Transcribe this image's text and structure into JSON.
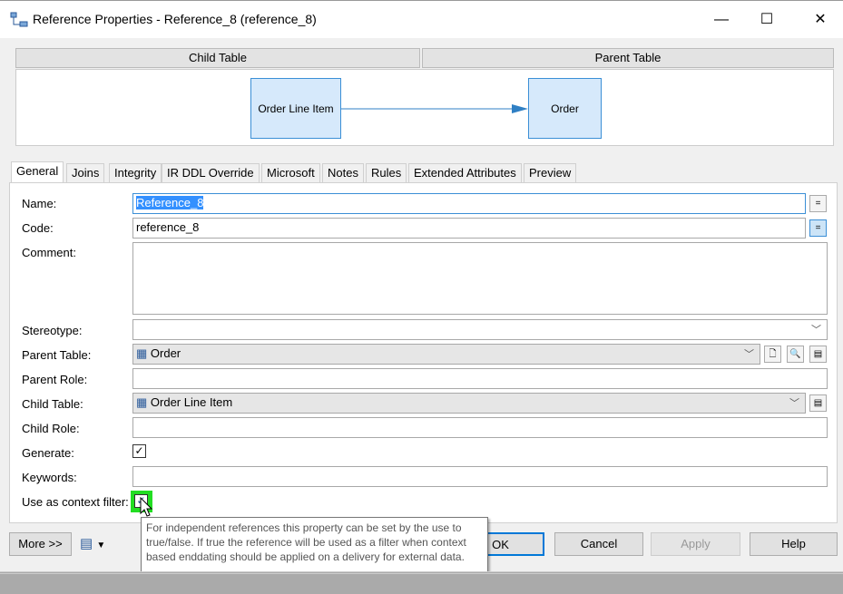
{
  "window": {
    "title": "Reference Properties - Reference_8 (reference_8)",
    "icon": "reference-icon",
    "minimize": "—",
    "maximize": "☐",
    "close": "✕"
  },
  "header": {
    "child_table": "Child Table",
    "parent_table": "Parent Table"
  },
  "diagram": {
    "child": "Order Line Item",
    "parent": "Order",
    "accent": "#3b8fd6"
  },
  "tabs": [
    "General",
    "Joins",
    "Integrity",
    "IR DDL Override",
    "Microsoft",
    "Notes",
    "Rules",
    "Extended Attributes",
    "Preview"
  ],
  "active_tab": "General",
  "form": {
    "name_label": "Name:",
    "name_value": "Reference_8",
    "code_label": "Code:",
    "code_value": "reference_8",
    "comment_label": "Comment:",
    "comment_value": "",
    "stereotype_label": "Stereotype:",
    "stereotype_value": "",
    "parent_table_label": "Parent Table:",
    "parent_table_value": "Order",
    "parent_role_label": "Parent Role:",
    "parent_role_value": "",
    "child_table_label": "Child Table:",
    "child_table_value": "Order Line Item",
    "child_role_label": "Child Role:",
    "child_role_value": "",
    "generate_label": "Generate:",
    "generate_checked": true,
    "keywords_label": "Keywords:",
    "keywords_value": "",
    "context_filter_label": "Use as context filter:",
    "context_filter_checked": true,
    "equals": "="
  },
  "tooltip": "For independent references this property can be set by the use to true/false. If true the reference will be used as a filter when context based enddating should be applied on a delivery for external data.",
  "buttons": {
    "more": "More >>",
    "ok": "OK",
    "cancel": "Cancel",
    "apply": "Apply",
    "help": "Help"
  }
}
